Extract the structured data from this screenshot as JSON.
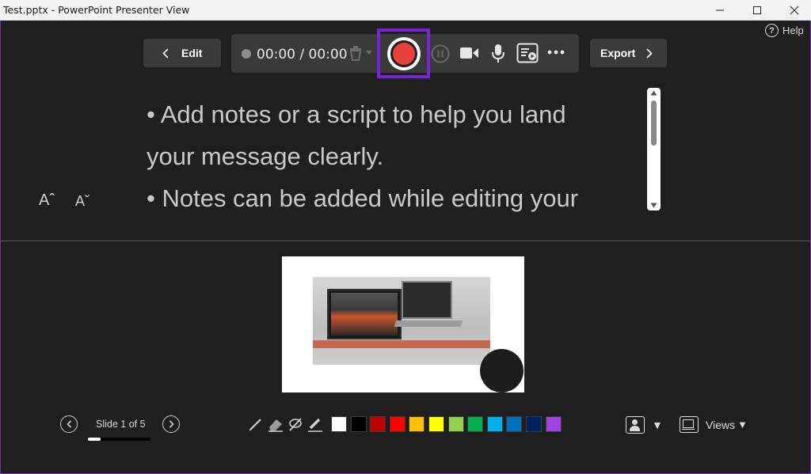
{
  "window": {
    "title": "Test.pptx - PowerPoint Presenter View",
    "minimize_icon": "minimize-icon",
    "maximize_icon": "maximize-icon",
    "close_icon": "close-icon"
  },
  "help": {
    "label": "Help",
    "icon": "help-circle-icon",
    "glyph": "?"
  },
  "toolbar": {
    "edit_label": "Edit",
    "export_label": "Export",
    "timer": "00:00 / 00:00",
    "icons": [
      "recording-dot-icon",
      "trash-icon",
      "record-icon",
      "pause-icon",
      "video-camera-icon",
      "microphone-icon",
      "teleprompter-icon",
      "more-options-icon"
    ],
    "record_highlight_color": "#7a22d6",
    "record_color": "#e8403c"
  },
  "notes": {
    "lines": [
      "• Add notes or a script to help you land",
      "your message clearly.",
      "• Notes can be added while editing your"
    ],
    "increase_font_label": "Aˆ",
    "decrease_font_label": "Aˇ"
  },
  "slide_nav": {
    "label": "Slide 1 of 5",
    "progress": 0.2
  },
  "ink_tools": [
    "pen-icon",
    "eraser-icon",
    "lasso-icon",
    "highlighter-icon"
  ],
  "palette": [
    "#ffffff",
    "#000000",
    "#c00000",
    "#ff0000",
    "#ffc000",
    "#ffff00",
    "#92d050",
    "#00b050",
    "#00b0f0",
    "#0070c0",
    "#002060",
    "#a040e0"
  ],
  "right_controls": {
    "camera_icon": "camera-view-icon",
    "views_label": "Views",
    "views_icon": "views-layout-icon",
    "dropdown_arrow": "▼"
  }
}
